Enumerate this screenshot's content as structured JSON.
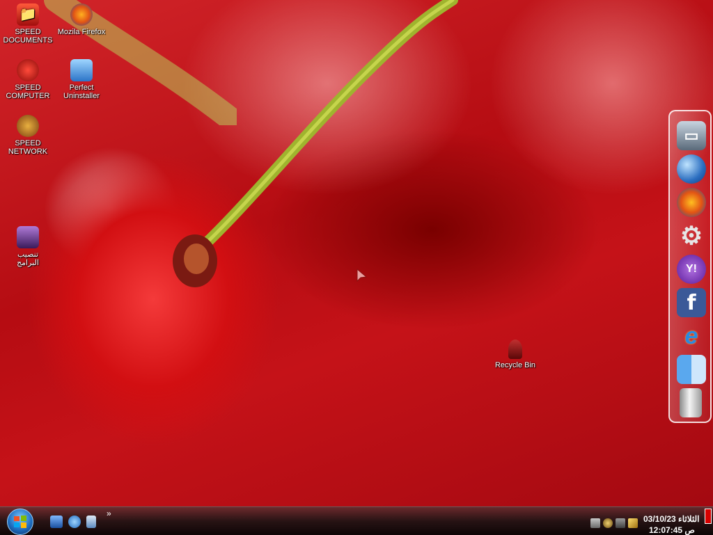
{
  "desktop": {
    "icons": [
      {
        "label": "SPEED\nDOCUMENTS",
        "icon": "folder-documents-icon"
      },
      {
        "label": "Mozila Firefox",
        "icon": "firefox-icon"
      },
      {
        "label": "SPEED\nCOMPUTER",
        "icon": "computer-icon"
      },
      {
        "label": "Perfect\nUninstaller",
        "icon": "uninstaller-icon"
      },
      {
        "label": "SPEED\nNETWORK",
        "icon": "network-icon"
      },
      {
        "label": "تنصيب\nالبرامج",
        "icon": "programs-folder-icon"
      },
      {
        "label": "Recycle Bin",
        "icon": "recycle-bin-icon"
      }
    ]
  },
  "dock": {
    "items": [
      {
        "icon": "computer-icon",
        "glyph": "▭"
      },
      {
        "icon": "globe-icon",
        "glyph": ""
      },
      {
        "icon": "firefox-icon",
        "glyph": ""
      },
      {
        "icon": "gear-icon",
        "glyph": "⚙"
      },
      {
        "icon": "yahoo-messenger-icon",
        "glyph": "Y!"
      },
      {
        "icon": "facebook-icon",
        "glyph": "f"
      },
      {
        "icon": "internet-explorer-icon",
        "glyph": "e"
      },
      {
        "icon": "finder-icon",
        "glyph": ""
      },
      {
        "icon": "trash-icon",
        "glyph": ""
      }
    ]
  },
  "taskbar": {
    "quicklaunch_chevron": "»",
    "clock": {
      "date": "الثلاثاء 03/10/23",
      "time": "ص 12:07:45"
    }
  },
  "colors": {
    "accent": "#d20f12",
    "taskbar": "#141414"
  }
}
